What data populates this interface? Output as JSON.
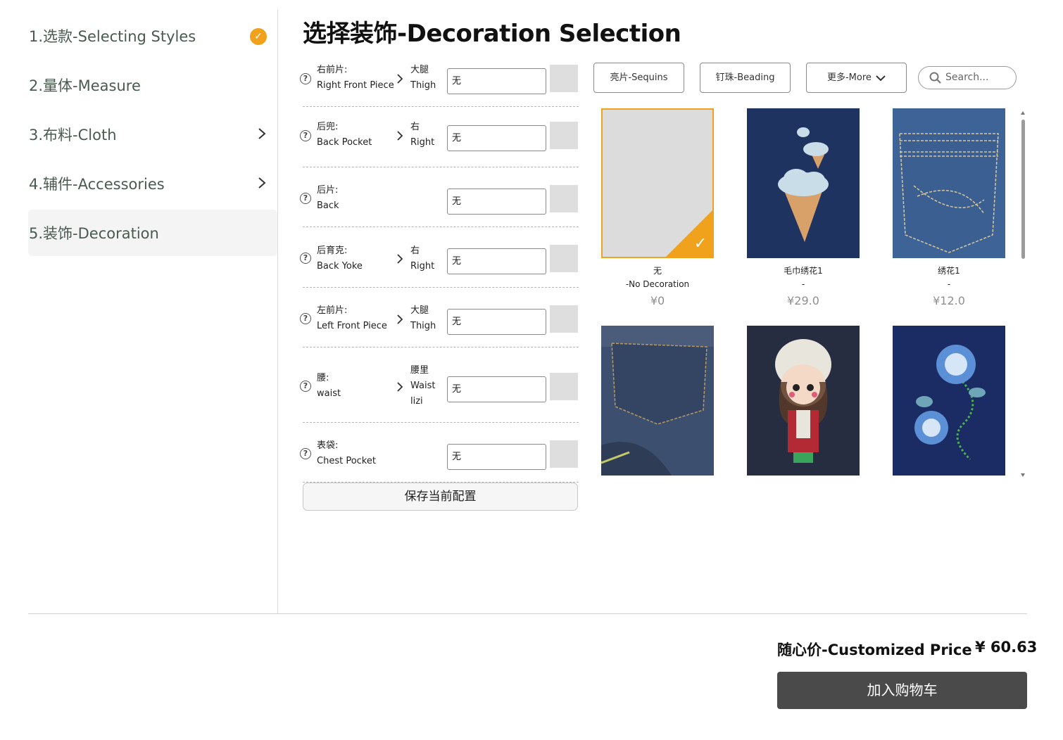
{
  "sidebar": {
    "steps": [
      {
        "label": "1.选款-Selecting Styles",
        "done": true
      },
      {
        "label": "2.量体-Measure"
      },
      {
        "label": "3.布料-Cloth",
        "has_children": true
      },
      {
        "label": "4.辅件-Accessories",
        "has_children": true
      },
      {
        "label": "5.装饰-Decoration",
        "active": true
      }
    ]
  },
  "page_title": "选择装饰-Decoration Selection",
  "parts": [
    {
      "name_cn": "右前片:",
      "name_en": "Right Front Piece",
      "loc_cn": "大腿",
      "loc_en": "Thigh",
      "value": "无"
    },
    {
      "name_cn": "后兜:",
      "name_en": "Back Pocket",
      "loc_cn": "右",
      "loc_en": "Right",
      "value": "无"
    },
    {
      "name_cn": "后片:",
      "name_en": "Back",
      "value": "无"
    },
    {
      "name_cn": "后育克:",
      "name_en": "Back Yoke",
      "loc_cn": "右",
      "loc_en": "Right",
      "value": "无"
    },
    {
      "name_cn": "左前片:",
      "name_en": "Left Front Piece",
      "loc_cn": "大腿",
      "loc_en": "Thigh",
      "value": "无"
    },
    {
      "name_cn": "腰:",
      "name_en": "waist",
      "loc_cn": "腰里",
      "loc_en": "Waist",
      "loc_extra": "lizi",
      "value": "无"
    },
    {
      "name_cn": "表袋:",
      "name_en": "Chest Pocket",
      "value": "无"
    }
  ],
  "save_button": "保存当前配置",
  "filters": {
    "sequins": "亮片-Sequins",
    "beading": "钉珠-Beading",
    "more": "更多-More",
    "search_placeholder": "Search..."
  },
  "gallery": [
    {
      "name": "无",
      "sub": "-No Decoration",
      "price": "¥0",
      "selected": true
    },
    {
      "name": "毛巾绣花1",
      "sub": "-",
      "price": "¥29.0"
    },
    {
      "name": "绣花1",
      "sub": "-",
      "price": "¥12.0"
    },
    {
      "name": "",
      "sub": "",
      "price": ""
    },
    {
      "name": "",
      "sub": "",
      "price": ""
    },
    {
      "name": "",
      "sub": "",
      "price": ""
    }
  ],
  "footer": {
    "price_label": "随心价-Customized Price",
    "price_value": "¥ 60.63",
    "cart_button": "加入购物车"
  },
  "colors": {
    "accent": "#f0a21c",
    "cart_button": "#4a4a4a",
    "denim": "#1e3360"
  },
  "icons": {
    "step_done": "check-circle-icon",
    "step_expand": "chevron-right-icon",
    "help": "question-circle-icon",
    "location_arrow": "chevron-right-icon",
    "more_dropdown": "chevron-down-icon",
    "search": "search-icon",
    "selected_ribbon": "check-icon"
  }
}
